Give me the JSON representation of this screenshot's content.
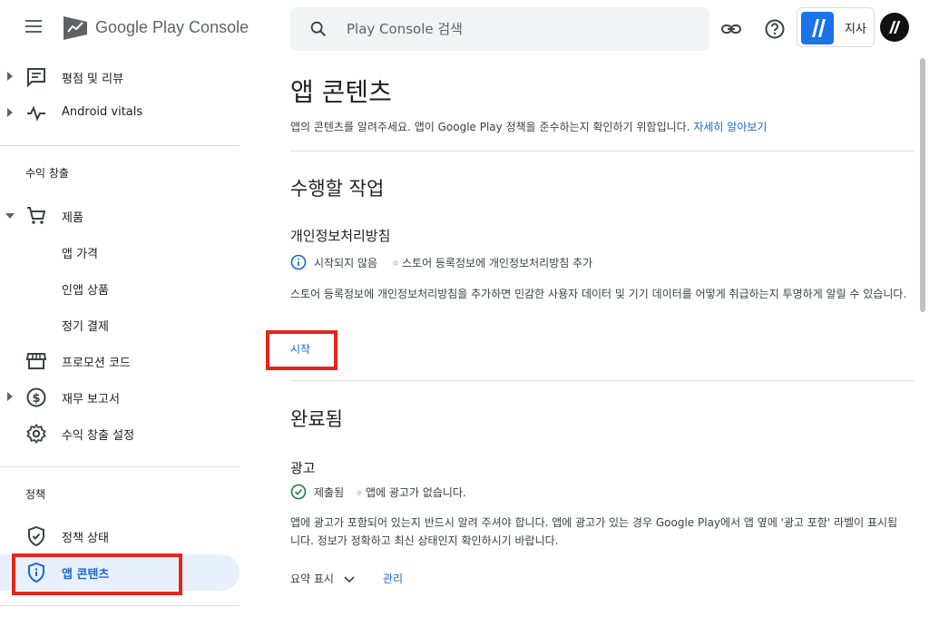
{
  "header": {
    "brand": "Google Play Console",
    "search_placeholder": "Play Console 검색",
    "account_name": "지사"
  },
  "sidebar": {
    "items_top": [
      {
        "label": "평점 및 리뷰",
        "icon": "reviews-icon"
      },
      {
        "label": "Android vitals",
        "icon": "vitals-icon"
      }
    ],
    "monetize_section": "수익 창출",
    "monetize_items": [
      {
        "label": "제품",
        "icon": "cart-icon"
      },
      {
        "label": "앱 가격"
      },
      {
        "label": "인앱 상품"
      },
      {
        "label": "정기 결제"
      },
      {
        "label": "프로모션 코드",
        "icon": "store-icon"
      },
      {
        "label": "재무 보고서",
        "icon": "dollar-icon"
      },
      {
        "label": "수익 창출 설정",
        "icon": "gear-icon"
      }
    ],
    "policy_section": "정책",
    "policy_items": [
      {
        "label": "정책 상태",
        "icon": "shield-check-icon"
      },
      {
        "label": "앱 콘텐츠",
        "icon": "shield-info-icon",
        "active": true
      }
    ]
  },
  "main": {
    "title": "앱 콘텐츠",
    "description": "앱의 콘텐츠를 알려주세요. 앱이 Google Play 정책을 준수하는지 확인하기 위함입니다.",
    "learn_more": "자세히 알아보기",
    "todo_heading": "수행할 작업",
    "todo_task": {
      "title": "개인정보처리방침",
      "status": "시작되지 않음",
      "status_detail": "스토어 등록정보에 개인정보처리방침 추가",
      "body": "스토어 등록정보에 개인정보처리방침을 추가하면 민감한 사용자 데이터 및 기기 데이터를 어떻게 취급하는지 투명하게 알릴 수 있습니다.",
      "action": "시작"
    },
    "done_heading": "완료됨",
    "done_task": {
      "title": "광고",
      "status": "제출됨",
      "status_detail": "앱에 광고가 없습니다.",
      "body": "앱에 광고가 포함되어 있는지 반드시 알려 주셔야 합니다. 앱에 광고가 있는 경우 Google Play에서 앱 옆에 '광고 포함' 라벨이 표시됩니다. 정보가 정확하고 최신 상태인지 확인하시기 바랍니다.",
      "summary_toggle": "요약 표시",
      "manage": "관리"
    }
  },
  "colors": {
    "accent": "#1967d2",
    "highlight": "#e5261a",
    "success": "#188038",
    "active_bg": "#e8f0fe"
  }
}
